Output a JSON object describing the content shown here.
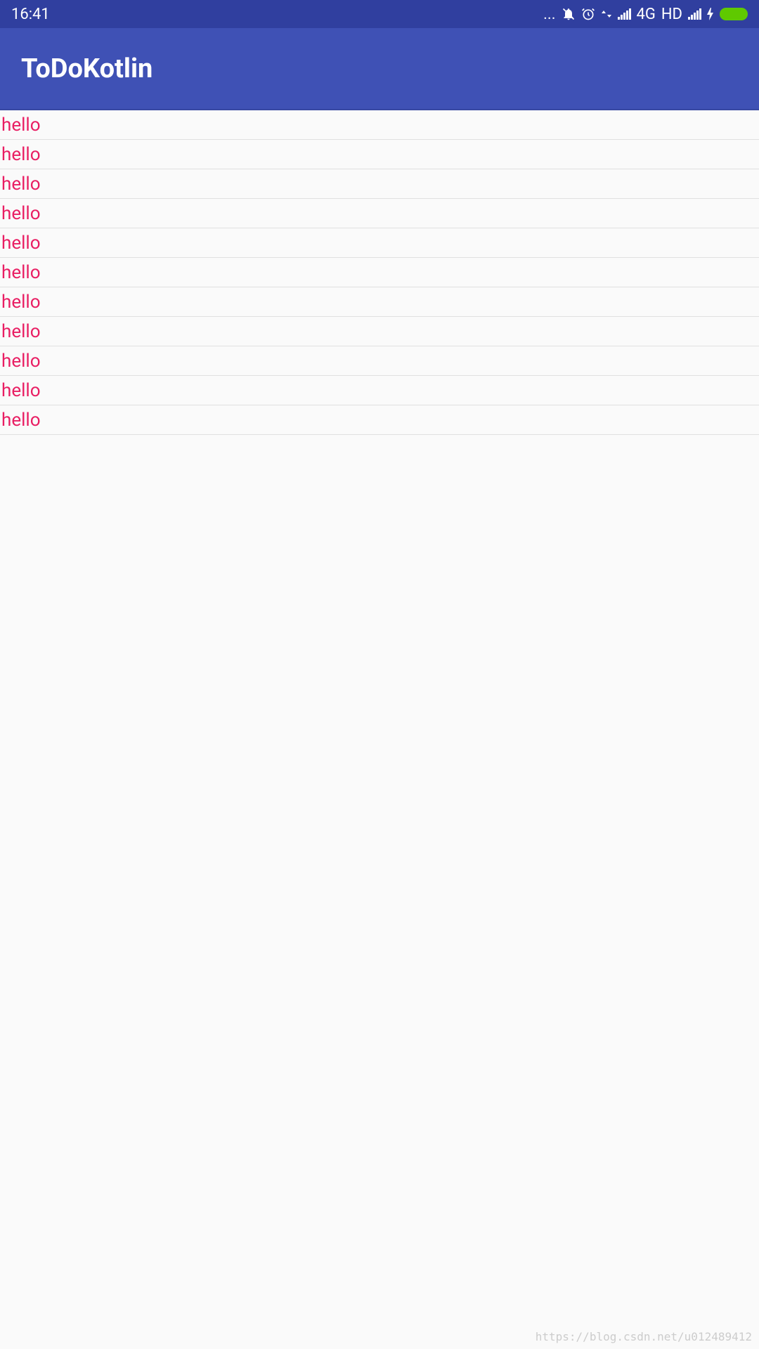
{
  "status_bar": {
    "time": "16:41",
    "network_type": "4G",
    "hd_label": "HD",
    "dots": "..."
  },
  "app_bar": {
    "title": "ToDoKotlin"
  },
  "list": {
    "items": [
      {
        "text": "hello"
      },
      {
        "text": "hello"
      },
      {
        "text": "hello"
      },
      {
        "text": "hello"
      },
      {
        "text": "hello"
      },
      {
        "text": "hello"
      },
      {
        "text": "hello"
      },
      {
        "text": "hello"
      },
      {
        "text": "hello"
      },
      {
        "text": "hello"
      },
      {
        "text": "hello"
      }
    ]
  },
  "watermark": "https://blog.csdn.net/u012489412",
  "colors": {
    "status_bar_bg": "#303f9f",
    "app_bar_bg": "#3f51b5",
    "list_text": "#e91e63",
    "battery": "#5fc900"
  }
}
